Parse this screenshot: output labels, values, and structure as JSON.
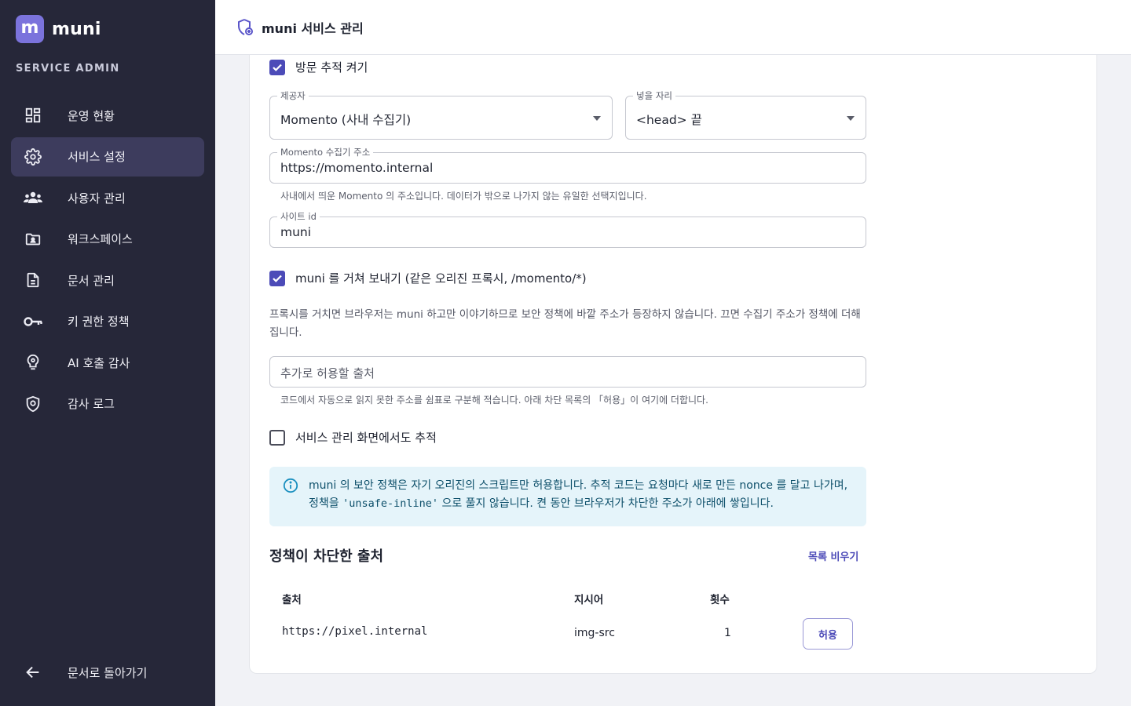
{
  "brand": {
    "logo_letter": "m",
    "name": "muni"
  },
  "sidebar": {
    "section_label": "SERVICE ADMIN",
    "items": [
      {
        "label": "운영 현황",
        "icon": "dashboard-icon",
        "active": false
      },
      {
        "label": "서비스 설정",
        "icon": "gear-icon",
        "active": true
      },
      {
        "label": "사용자 관리",
        "icon": "users-icon",
        "active": false
      },
      {
        "label": "워크스페이스",
        "icon": "folder-user-icon",
        "active": false
      },
      {
        "label": "문서 관리",
        "icon": "document-icon",
        "active": false
      },
      {
        "label": "키 권한 정책",
        "icon": "key-icon",
        "active": false
      },
      {
        "label": "AI 호출 감사",
        "icon": "brain-icon",
        "active": false
      },
      {
        "label": "감사 로그",
        "icon": "shield-icon",
        "active": false
      }
    ],
    "back_label": "문서로 돌아가기"
  },
  "header": {
    "title": "muni 서비스 관리"
  },
  "tracking": {
    "enable_label": "방문 추적 켜기",
    "enabled": true,
    "provider": {
      "label": "제공자",
      "value": "Momento (사내 수집기)"
    },
    "placement": {
      "label": "넣을 자리",
      "value": "<head> 끝"
    },
    "collector": {
      "label": "Momento 수집기 주소",
      "value": "https://momento.internal",
      "helper": "사내에서 띄운 Momento 의 주소입니다. 데이터가 밖으로 나가지 않는 유일한 선택지입니다."
    },
    "site_id": {
      "label": "사이트 id",
      "value": "muni"
    },
    "proxy_label": "muni 를 거쳐 보내기 (같은 오리진 프록시, /momento/*)",
    "proxy_enabled": true,
    "proxy_description": "프록시를 거치면 브라우저는 muni 하고만 이야기하므로 보안 정책에 바깥 주소가 등장하지 않습니다. 끄면 수집기 주소가 정책에 더해집니다.",
    "extra_origins": {
      "placeholder": "추가로 허용할 출처",
      "helper": "코드에서 자동으로 읽지 못한 주소를 쉼표로 구분해 적습니다. 아래 차단 목록의 「허용」이 여기에 더합니다."
    },
    "admin_tracking_label": "서비스 관리 화면에서도 추적",
    "admin_tracking_enabled": false,
    "info": {
      "text_before": "muni 의 보안 정책은 자기 오리진의 스크립트만 허용합니다. 추적 코드는 요청마다 새로 만든 nonce 를 달고 나가며, 정책을 ",
      "code": "'unsafe-inline'",
      "text_after": " 으로 풀지 않습니다. 켠 동안 브라우저가 차단한 주소가 아래에 쌓입니다."
    }
  },
  "blocked": {
    "title": "정책이 차단한 출처",
    "clear_label": "목록 비우기",
    "columns": {
      "source": "출처",
      "directive": "지시어",
      "count": "횟수"
    },
    "rows": [
      {
        "source": "https://pixel.internal",
        "directive": "img-src",
        "count": "1",
        "action": "허용"
      }
    ]
  },
  "colors": {
    "accent": "#4c4bb8",
    "sidebar_bg": "#262739",
    "info_bg": "#e5f4fa"
  }
}
